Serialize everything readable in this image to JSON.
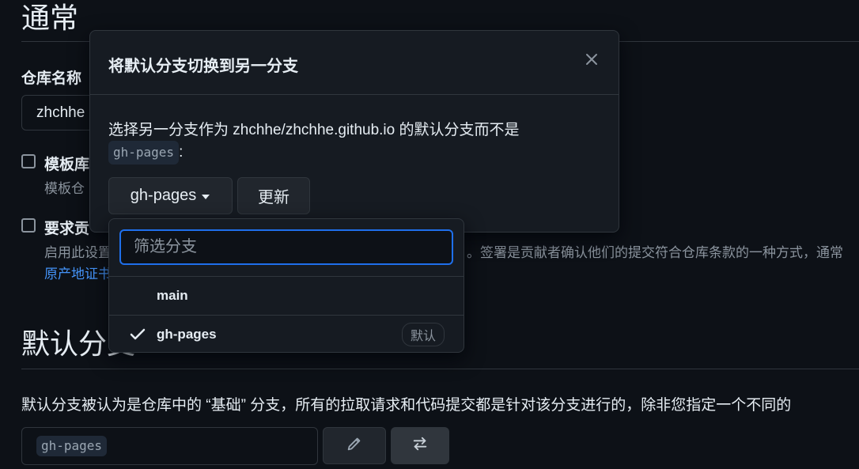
{
  "general": {
    "title": "通常",
    "repo_name_label": "仓库名称",
    "repo_name_value": "zhchhe",
    "template": {
      "label": "模板库",
      "desc": "模板仓"
    },
    "signoff": {
      "label": "要求贡",
      "desc_left": "启用此设置",
      "desc_right": "。签署是贡献者确认他们的提交符合仓库条款的一种方式，通常",
      "link": "原产地证书"
    }
  },
  "default_branch": {
    "title": "默认分支",
    "description": "默认分支被认为是仓库中的 “基础” 分支，所有的拉取请求和代码提交都是针对该分支进行的，除非您指定一个不同的",
    "current": "gh-pages"
  },
  "modal": {
    "title": "将默认分支切换到另一分支",
    "text_line1": "选择另一分支作为 zhchhe/zhchhe.github.io 的默认分支而不是",
    "current_branch": "gh-pages",
    "colon": ":",
    "branch_button": "gh-pages",
    "update_button": "更新"
  },
  "dropdown": {
    "filter_placeholder": "筛选分支",
    "items": [
      {
        "name": "main",
        "selected": false
      },
      {
        "name": "gh-pages",
        "selected": true,
        "badge": "默认"
      }
    ]
  },
  "colors": {
    "background": "#0d1117",
    "panel": "#161b22",
    "border": "#30363d",
    "accent": "#1f6feb",
    "link": "#4493f8"
  }
}
